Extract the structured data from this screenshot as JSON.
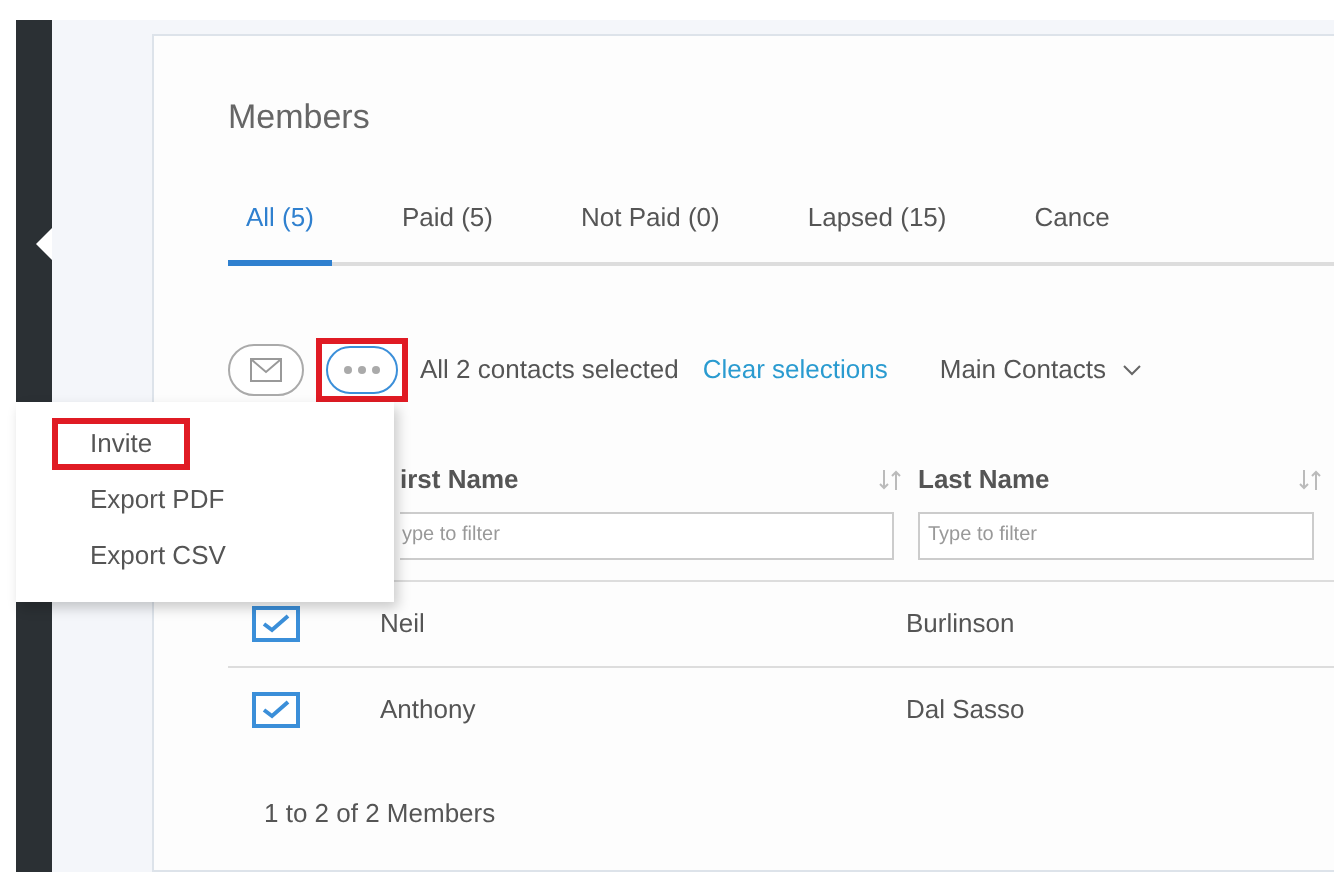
{
  "page": {
    "title": "Members"
  },
  "tabs": [
    {
      "label": "All (5)",
      "selected": true
    },
    {
      "label": "Paid (5)",
      "selected": false
    },
    {
      "label": "Not Paid (0)",
      "selected": false
    },
    {
      "label": "Lapsed (15)",
      "selected": false
    },
    {
      "label": "Cance",
      "selected": false
    }
  ],
  "toolbar": {
    "more_highlighted": true,
    "selection_text": "All 2 contacts selected",
    "clear_link": "Clear selections",
    "view": "Main Contacts"
  },
  "menu": [
    {
      "label": "Invite",
      "highlighted": true
    },
    {
      "label": "Export PDF",
      "highlighted": false
    },
    {
      "label": "Export CSV",
      "highlighted": false
    }
  ],
  "table": {
    "columns": [
      {
        "label": "irst Name",
        "placeholder": "ype to filter"
      },
      {
        "label": "Last Name",
        "placeholder": "Type to filter"
      }
    ],
    "rows": [
      {
        "checked": true,
        "cells": [
          "Neil",
          "Burlinson"
        ]
      },
      {
        "checked": true,
        "cells": [
          "Anthony",
          "Dal Sasso"
        ]
      }
    ]
  },
  "footer": "1 to 2 of 2 Members"
}
